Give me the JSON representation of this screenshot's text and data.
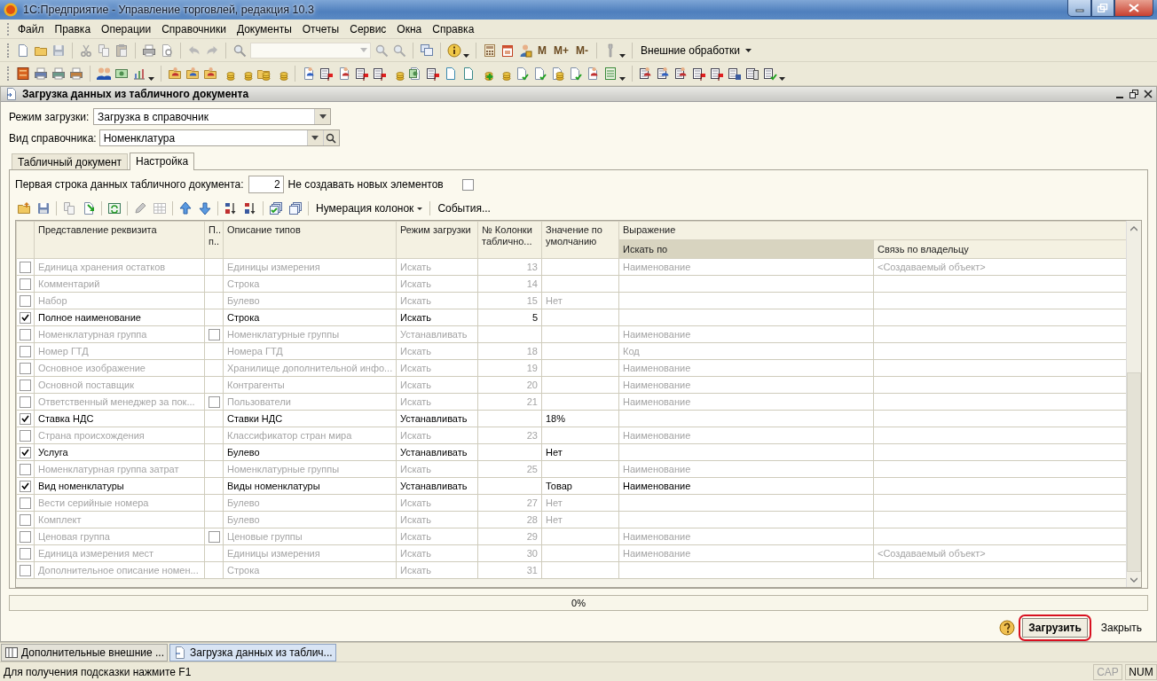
{
  "window": {
    "title": "1С:Предприятие - Управление торговлей, редакция 10.3"
  },
  "menu": [
    "Файл",
    "Правка",
    "Операции",
    "Справочники",
    "Документы",
    "Отчеты",
    "Сервис",
    "Окна",
    "Справка"
  ],
  "toolbar": {
    "m_buttons": [
      "M",
      "M+",
      "M-"
    ],
    "external": "Внешние обработки"
  },
  "form": {
    "title": "Загрузка данных из табличного документа",
    "fields": [
      {
        "label": "Режим загрузки:",
        "value": "Загрузка в справочник",
        "kind": "dropdown"
      },
      {
        "label": "Вид справочника:",
        "value": "Номенклатура",
        "kind": "lookup"
      }
    ],
    "tabs": [
      {
        "label": "Табличный документ",
        "selected": false
      },
      {
        "label": "Настройка",
        "selected": true
      }
    ],
    "first_row": {
      "label": "Первая строка данных табличного документа:",
      "value": "2"
    },
    "no_new": {
      "label": "Не создавать новых элементов",
      "checked": false
    },
    "table_toolbar": {
      "numbering": "Нумерация колонок",
      "events": "События..."
    },
    "table": {
      "columns": [
        "Представление реквизита",
        "П.. п..",
        "Описание типов",
        "Режим загрузки",
        "№ Колонки таблично...",
        "Значение по умолчанию"
      ],
      "group": {
        "label": "Выражение",
        "columns": [
          {
            "label": "Искать по",
            "selected": true
          },
          {
            "label": "Связь по владельцу",
            "selected": false
          }
        ]
      },
      "rows": [
        {
          "checked": false,
          "name": "Единица хранения остатков",
          "type": "Единицы измерения",
          "mode": "Искать",
          "column": "13",
          "search_by": "Наименование",
          "owner_link": "<Создаваемый объект>"
        },
        {
          "checked": false,
          "name": "Комментарий",
          "type": "Строка",
          "mode": "Искать",
          "column": "14"
        },
        {
          "checked": false,
          "name": "Набор",
          "type": "Булево",
          "mode": "Искать",
          "column": "15",
          "default": "Нет"
        },
        {
          "checked": true,
          "name": "Полное наименование",
          "type": "Строка",
          "mode": "Искать",
          "column": "5"
        },
        {
          "checked": false,
          "name": "Номенклатурная группа",
          "p_checked": false,
          "type": "Номенклатурные группы",
          "mode": "Устанавливать",
          "search_by": "Наименование"
        },
        {
          "checked": false,
          "name": "Номер ГТД",
          "type": "Номера ГТД",
          "mode": "Искать",
          "column": "18",
          "search_by": "Код"
        },
        {
          "checked": false,
          "name": "Основное изображение",
          "type": "Хранилище дополнительной инфо...",
          "mode": "Искать",
          "column": "19",
          "search_by": "Наименование"
        },
        {
          "checked": false,
          "name": "Основной поставщик",
          "type": "Контрагенты",
          "mode": "Искать",
          "column": "20",
          "search_by": "Наименование"
        },
        {
          "checked": false,
          "name": "Ответственный менеджер за пок...",
          "p_checked": false,
          "type": "Пользователи",
          "mode": "Искать",
          "column": "21",
          "search_by": "Наименование"
        },
        {
          "checked": true,
          "name": "Ставка НДС",
          "type": "Ставки НДС",
          "mode": "Устанавливать",
          "default": "18%"
        },
        {
          "checked": false,
          "name": "Страна происхождения",
          "type": "Классификатор стран мира",
          "mode": "Искать",
          "column": "23",
          "search_by": "Наименование"
        },
        {
          "checked": true,
          "name": "Услуга",
          "type": "Булево",
          "mode": "Устанавливать",
          "default": "Нет"
        },
        {
          "checked": false,
          "name": "Номенклатурная группа затрат",
          "type": "Номенклатурные группы",
          "mode": "Искать",
          "column": "25",
          "search_by": "Наименование"
        },
        {
          "checked": true,
          "name": "Вид номенклатуры",
          "type": "Виды номенклатуры",
          "mode": "Устанавливать",
          "default": "Товар",
          "search_by": "Наименование"
        },
        {
          "checked": false,
          "name": "Вести серийные номера",
          "type": "Булево",
          "mode": "Искать",
          "column": "27",
          "default": "Нет"
        },
        {
          "checked": false,
          "name": "Комплект",
          "type": "Булево",
          "mode": "Искать",
          "column": "28",
          "default": "Нет"
        },
        {
          "checked": false,
          "name": "Ценовая группа",
          "p_checked": false,
          "type": "Ценовые группы",
          "mode": "Искать",
          "column": "29",
          "search_by": "Наименование"
        },
        {
          "checked": false,
          "name": "Единица измерения мест",
          "type": "Единицы измерения",
          "mode": "Искать",
          "column": "30",
          "search_by": "Наименование",
          "owner_link": "<Создаваемый объект>"
        },
        {
          "checked": false,
          "name": "Дополнительное описание номен...",
          "type": "Строка",
          "mode": "Искать",
          "column": "31"
        }
      ]
    },
    "progress": {
      "level": 0,
      "text": "0%"
    },
    "buttons": [
      {
        "label": "Загрузить",
        "kind": "default",
        "highlighted": true
      },
      {
        "label": "Закрыть",
        "kind": "plain",
        "highlighted": false
      }
    ]
  },
  "taskbar": [
    {
      "label": "Дополнительные внешние ...",
      "kind": "list",
      "selected": false
    },
    {
      "label": "Загрузка данных из таблич...",
      "kind": "form",
      "selected": true
    }
  ],
  "status_bar": {
    "hint": "Для получения подсказки нажмите F1",
    "indicators": [
      {
        "label": "CAP",
        "on": false
      },
      {
        "label": "NUM",
        "on": true
      }
    ]
  }
}
